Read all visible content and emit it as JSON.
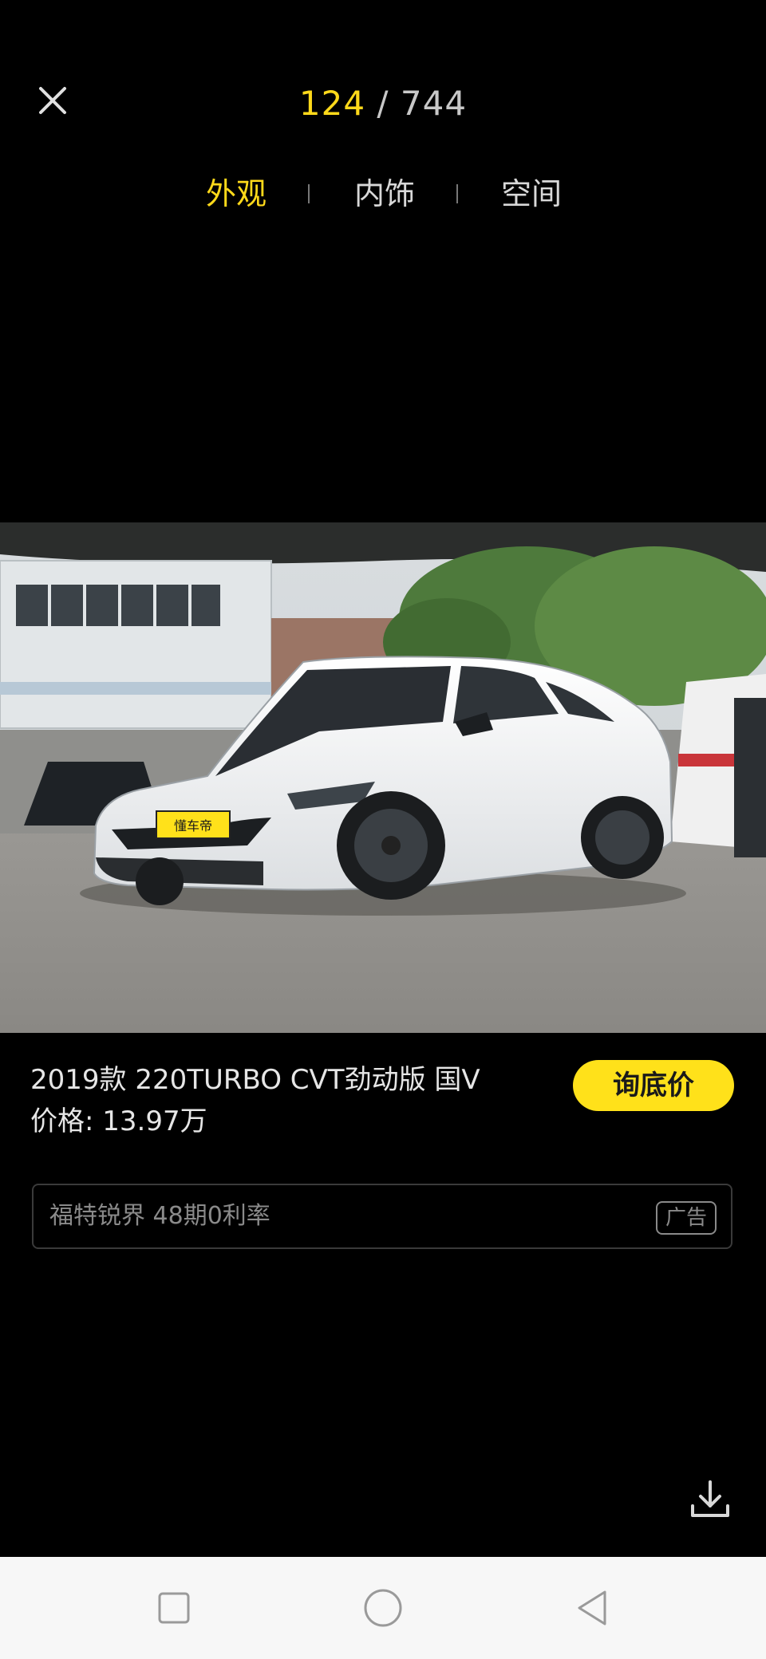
{
  "header": {
    "current_index": "124",
    "separator": " / ",
    "total": "744"
  },
  "tabs": [
    {
      "label": "外观",
      "active": true
    },
    {
      "label": "内饰",
      "active": false
    },
    {
      "label": "空间",
      "active": false
    }
  ],
  "photo": {
    "plate_logo_text": "懂车帝"
  },
  "car": {
    "title": "2019款 220TURBO CVT劲动版 国V",
    "price": "价格: 13.97万",
    "inquire_label": "询底价"
  },
  "ad": {
    "text": "福特锐界 48期0利率",
    "badge": "广告"
  },
  "colors": {
    "accent": "#ffd91a",
    "button": "#ffe11a",
    "background": "#000000",
    "navbar": "#f7f7f7"
  },
  "icons": {
    "close": "close-icon",
    "download": "download-icon",
    "nav_recent": "square-icon",
    "nav_home": "circle-icon",
    "nav_back": "triangle-back-icon"
  }
}
